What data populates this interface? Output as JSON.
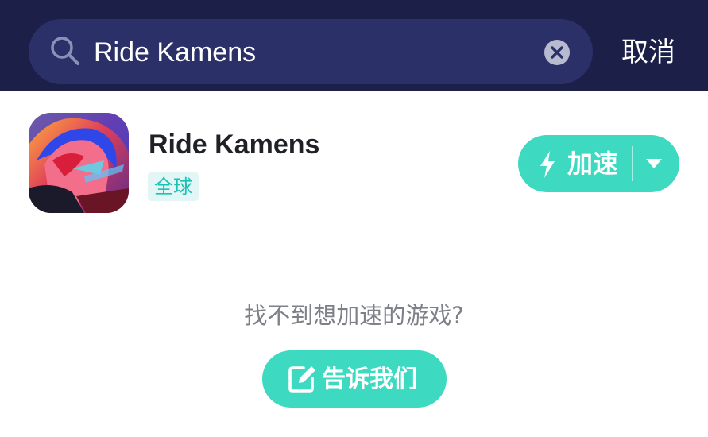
{
  "search": {
    "query": "Ride Kamens",
    "cancel_label": "取消"
  },
  "result": {
    "game_title": "Ride Kamens",
    "region_tag": "全球",
    "speed_button_label": "加速"
  },
  "empty_help": {
    "prompt": "找不到想加速的游戏?",
    "tell_us_label": "告诉我们"
  },
  "icons": {
    "search": "search-icon",
    "clear": "clear-icon",
    "bolt": "lightning-bolt-icon",
    "caret": "chevron-down-icon",
    "edit": "edit-icon"
  },
  "colors": {
    "header_bg": "#1c1f47",
    "search_bg": "#2c3068",
    "accent": "#3dd9c1",
    "tag_text": "#19c2b4",
    "tag_bg": "#e2f7f5"
  }
}
